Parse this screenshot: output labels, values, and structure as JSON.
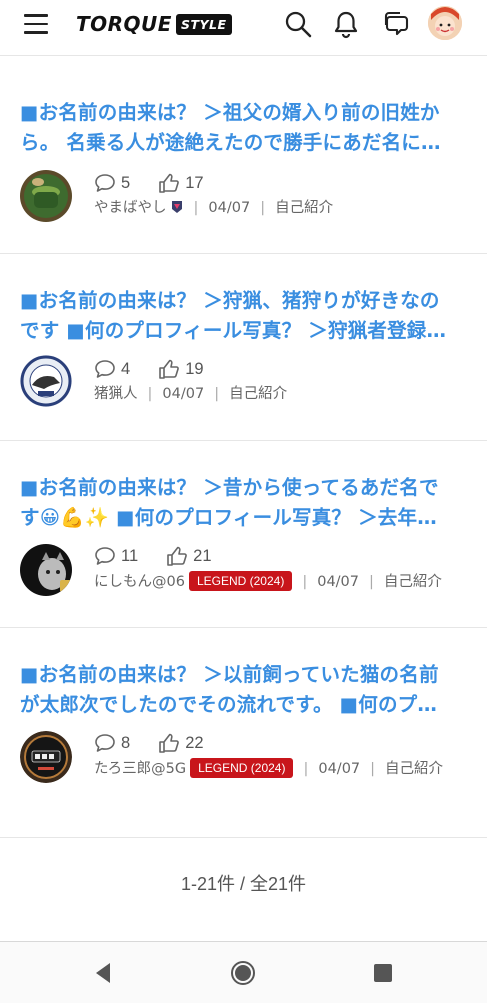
{
  "header": {
    "brand_main": "TORQUE",
    "brand_sub": "STYLE",
    "icons": [
      "menu-icon",
      "search-icon",
      "bell-icon",
      "chat-icon",
      "avatar"
    ]
  },
  "colors": {
    "title_blue": "#3a8ee0",
    "badge_red": "#c8151b"
  },
  "posts": [
    {
      "title_line1": "■お名前の由来は？ ＞祖父の婿入り前の旧姓か",
      "title_line2": "ら。 名乗る人が途絶えたので勝手にあだ名に…",
      "comments": "5",
      "likes": "17",
      "author": "やまばやし",
      "badge": "",
      "date": "04/07",
      "category": "自己紹介"
    },
    {
      "title_line1": "■お名前の由来は？ ＞狩猟、猪狩りが好きなの",
      "title_line2": "です ■何のプロフィール写真？ ＞狩猟者登録…",
      "comments": "4",
      "likes": "19",
      "author": "猪猟人",
      "badge": "",
      "date": "04/07",
      "category": "自己紹介"
    },
    {
      "title_line1": "■お名前の由来は？ ＞昔から使ってるあだ名で",
      "title_line2": "す😀💪✨ ■何のプロフィール写真？ ＞去年…",
      "comments": "11",
      "likes": "21",
      "author": "にしもん@06",
      "badge": "LEGEND (2024)",
      "date": "04/07",
      "category": "自己紹介"
    },
    {
      "title_line1": "■お名前の由来は？ ＞以前飼っていた猫の名前",
      "title_line2": "が太郎次でしたのでその流れです。 ■何のプ…",
      "comments": "8",
      "likes": "22",
      "author": "たろ三郎@5G",
      "badge": "LEGEND (2024)",
      "date": "04/07",
      "category": "自己紹介"
    }
  ],
  "pagination": {
    "text": "1-21件 / 全21件"
  },
  "navbar": {
    "icons": [
      "back-icon",
      "home-icon",
      "recents-icon"
    ]
  }
}
